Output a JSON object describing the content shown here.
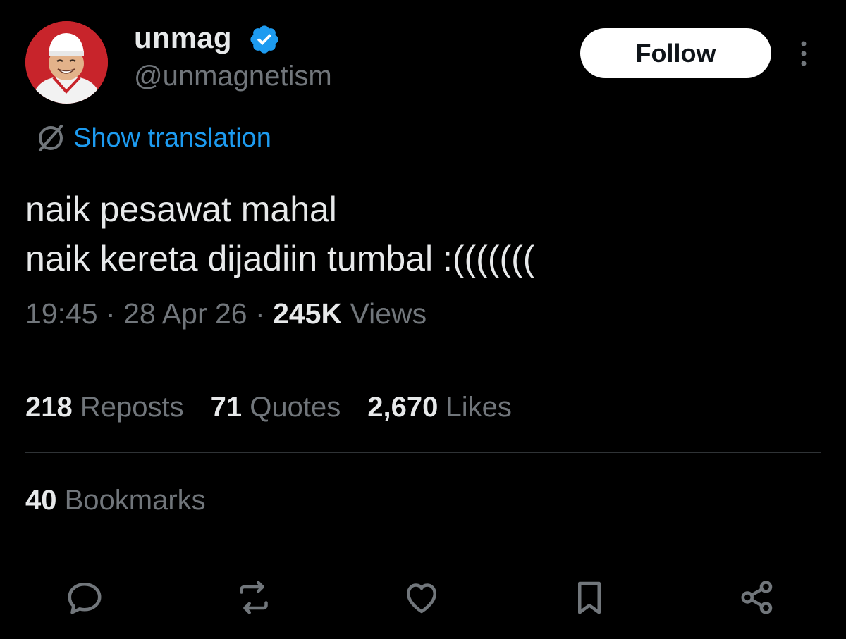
{
  "author": {
    "display_name": "unmag",
    "handle": "@unmagnetism",
    "verified": true,
    "avatar": "avatar"
  },
  "follow_label": "Follow",
  "translation_label": "Show translation",
  "tweet": {
    "lines": [
      "naik pesawat mahal",
      "naik kereta dijadiin tumbal :((((((("
    ]
  },
  "meta": {
    "time": "19:45",
    "date": "28 Apr 26",
    "views_count": "245K",
    "views_label": "Views",
    "separator": "·"
  },
  "stats": [
    {
      "count": "218",
      "label": "Reposts"
    },
    {
      "count": "71",
      "label": "Quotes"
    },
    {
      "count": "2,670",
      "label": "Likes"
    }
  ],
  "bookmarks": {
    "count": "40",
    "label": "Bookmarks"
  },
  "actions": [
    "reply-icon",
    "repost-icon",
    "like-icon",
    "bookmark-icon",
    "share-icon"
  ],
  "colors": {
    "background": "#000000",
    "text": "#e7e9ea",
    "secondary": "#71767b",
    "link": "#1d9bf0",
    "divider": "#2f3336"
  }
}
